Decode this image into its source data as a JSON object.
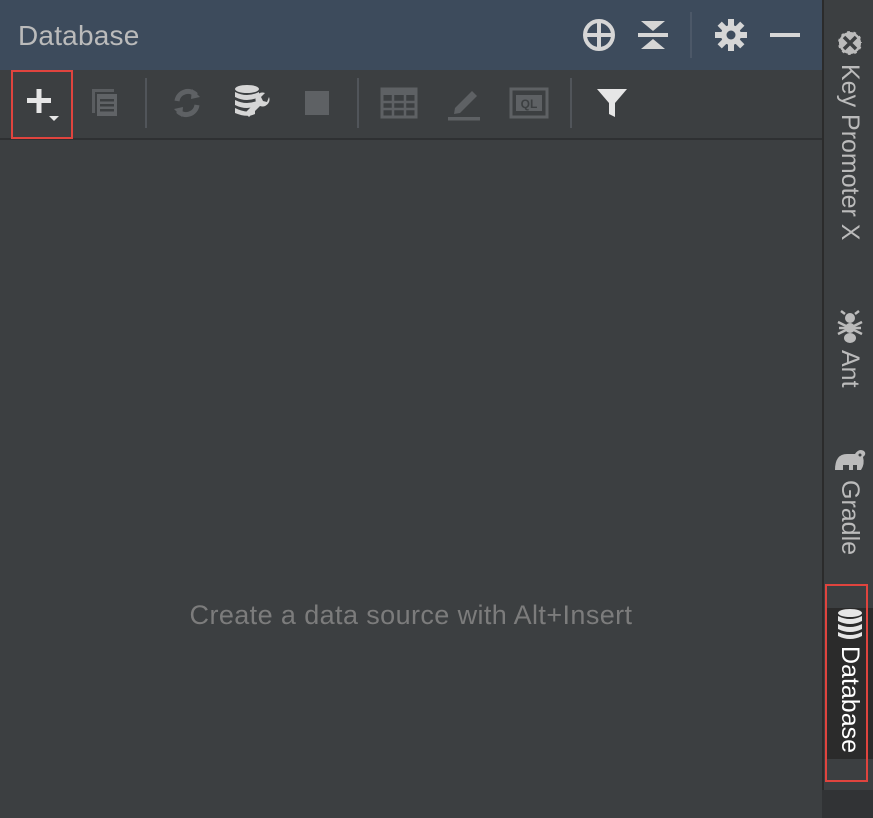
{
  "panel": {
    "title": "Database",
    "title_actions": [
      "crosshair-icon",
      "collapse-icon",
      "gear-icon",
      "minimize-icon"
    ],
    "toolbar": [
      {
        "name": "add-button",
        "icon": "plus-icon",
        "enabled": true,
        "highlighted": true
      },
      {
        "name": "duplicate-button",
        "icon": "copy-icon",
        "enabled": false
      },
      {
        "name": "refresh-button",
        "icon": "refresh-icon",
        "enabled": false
      },
      {
        "name": "data-source-properties-button",
        "icon": "db-wrench-icon",
        "enabled": true
      },
      {
        "name": "stop-button",
        "icon": "stop-icon",
        "enabled": false
      },
      {
        "name": "table-view-button",
        "icon": "table-icon",
        "enabled": false
      },
      {
        "name": "edit-button",
        "icon": "pencil-icon",
        "enabled": false
      },
      {
        "name": "query-console-button",
        "icon": "ql-icon",
        "enabled": false
      },
      {
        "name": "filter-button",
        "icon": "filter-icon",
        "enabled": true
      }
    ],
    "ql_text": "QL",
    "empty_message": "Create a data source with Alt+Insert"
  },
  "side_tabs": [
    {
      "label": "Key Promoter X",
      "icon": "key-promoter-icon",
      "active": false
    },
    {
      "label": "Ant",
      "icon": "ant-icon",
      "active": false
    },
    {
      "label": "Gradle",
      "icon": "elephant-icon",
      "active": false
    },
    {
      "label": "Database",
      "icon": "database-icon",
      "active": true
    }
  ],
  "colors": {
    "highlight": "#e0443e",
    "titlebar": "#3d4b5c",
    "background": "#3c3f41"
  }
}
